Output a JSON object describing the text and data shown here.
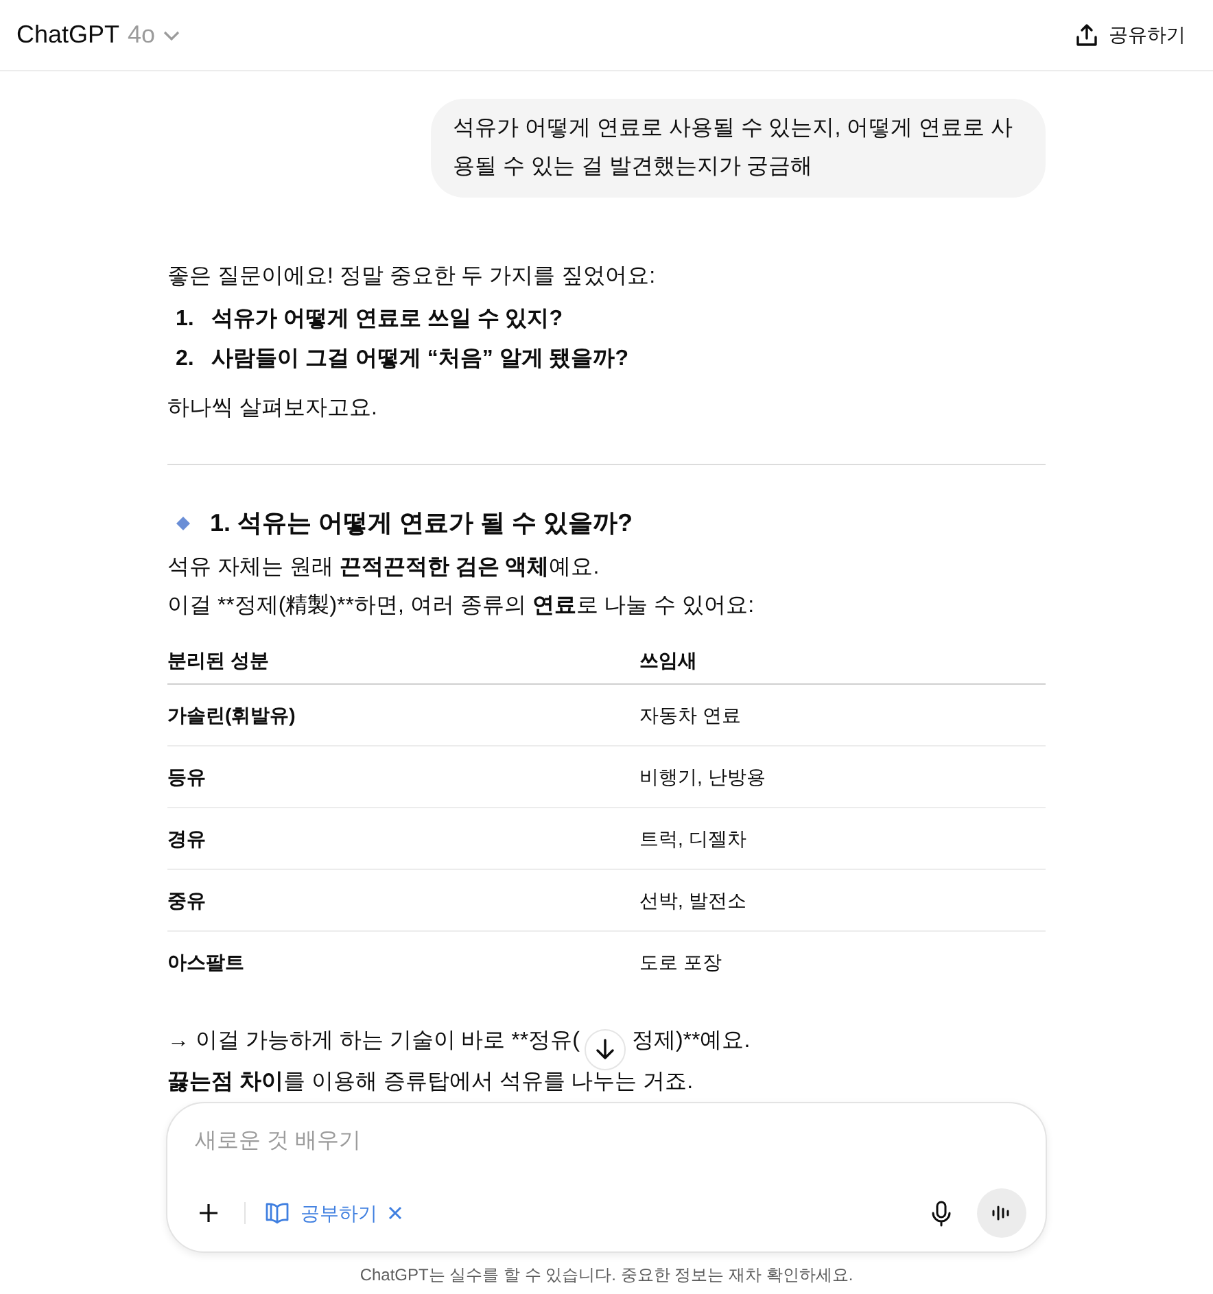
{
  "header": {
    "title": "ChatGPT",
    "model": "4o",
    "share": "공유하기"
  },
  "user_message": "석유가 어떻게 연료로 사용될 수 있는지, 어떻게 연료로 사용될 수 있는 걸 발견했는지가 궁금해",
  "answer": {
    "intro": "좋은 질문이에요! 정말 중요한 두 가지를 짚었어요:",
    "points": [
      {
        "number": "1.",
        "text": "석유가 어떻게 연료로 쓰일 수 있지?"
      },
      {
        "number": "2.",
        "text": "사람들이 그걸 어떻게 “처음” 알게 됐을까?"
      }
    ],
    "lead": "하나씩 살펴보자고요.",
    "section_heading": "1. 석유는 어떻게 연료가 될 수 있을까?",
    "paragraphs": [
      [
        {
          "text": "석유 자체는 원래 ",
          "bold": false
        },
        {
          "text": "끈적끈적한 검은 액체",
          "bold": true
        },
        {
          "text": "예요.",
          "bold": false
        }
      ],
      [
        {
          "text": "이걸 **정제(精製)**하면, 여러 종류의 ",
          "bold": false
        },
        {
          "text": "연료",
          "bold": true
        },
        {
          "text": "로 나눌 수 있어요:",
          "bold": false
        }
      ]
    ],
    "table": {
      "columns": [
        "분리된 성분",
        "쓰임새"
      ],
      "rows": [
        [
          "가솔린(휘발유)",
          "자동차 연료"
        ],
        [
          "등유",
          "비행기, 난방용"
        ],
        [
          "경유",
          "트럭, 디젤차"
        ],
        [
          "중유",
          "선박, 발전소"
        ],
        [
          "아스팔트",
          "도로 포장"
        ]
      ]
    },
    "closing": [
      {
        "before_button": "→ 이걸 가능하게 하는 기술이 바로 **정유(",
        "after_button": "정제)**예요."
      },
      [
        {
          "text": "끓는점 차이",
          "bold": true
        },
        {
          "text": "를 이용해 증류탑에서 석유를 나누는 거죠.",
          "bold": false
        }
      ]
    ]
  },
  "composer": {
    "placeholder": "새로운 것 배우기",
    "tool": {
      "label": "공부하기",
      "active": true
    }
  },
  "disclaimer": "ChatGPT는 실수를 할 수 있습니다. 중요한 정보는 재차 확인하세요."
}
